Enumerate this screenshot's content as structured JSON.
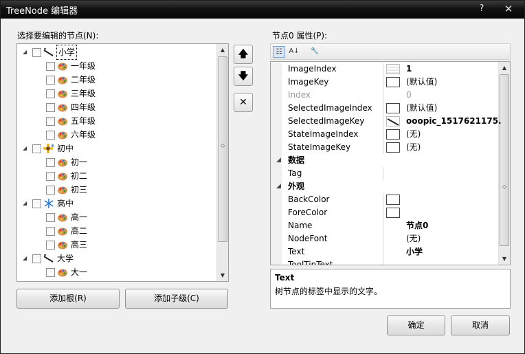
{
  "window": {
    "title": "TreeNode 编辑器",
    "help_glyph": "?",
    "close_glyph": "✕"
  },
  "tree_label": "选择要编辑的节点(N):",
  "tree": {
    "selected": "小学",
    "nodes": [
      {
        "label": "小学",
        "level": 0,
        "icon": "pen-icon",
        "expanded": true
      },
      {
        "label": "一年级",
        "level": 1,
        "icon": "palette-icon"
      },
      {
        "label": "二年级",
        "level": 1,
        "icon": "palette-icon"
      },
      {
        "label": "三年级",
        "level": 1,
        "icon": "palette-icon"
      },
      {
        "label": "四年级",
        "level": 1,
        "icon": "palette-icon"
      },
      {
        "label": "五年级",
        "level": 1,
        "icon": "palette-icon"
      },
      {
        "label": "六年级",
        "level": 1,
        "icon": "palette-icon"
      },
      {
        "label": "初中",
        "level": 0,
        "icon": "sunflower-icon",
        "expanded": true
      },
      {
        "label": "初一",
        "level": 1,
        "icon": "palette-icon"
      },
      {
        "label": "初二",
        "level": 1,
        "icon": "palette-icon"
      },
      {
        "label": "初三",
        "level": 1,
        "icon": "palette-icon"
      },
      {
        "label": "高中",
        "level": 0,
        "icon": "snowflake-icon",
        "expanded": true
      },
      {
        "label": "高一",
        "level": 1,
        "icon": "palette-icon"
      },
      {
        "label": "高二",
        "level": 1,
        "icon": "palette-icon"
      },
      {
        "label": "高三",
        "level": 1,
        "icon": "palette-icon"
      },
      {
        "label": "大学",
        "level": 0,
        "icon": "pen-icon",
        "expanded": true
      },
      {
        "label": "大一",
        "level": 1,
        "icon": "palette-icon"
      }
    ]
  },
  "side_buttons": {
    "up": "🡅",
    "down": "🡇",
    "delete": "✕"
  },
  "buttons": {
    "add_root": "添加根(R)",
    "add_child": "添加子级(C)",
    "ok": "确定",
    "cancel": "取消"
  },
  "properties_label": "节点0 属性(P):",
  "property_grid": {
    "rows": [
      {
        "kind": "prop",
        "name": "ImageIndex",
        "value": "1",
        "swatch": "image",
        "bold": true
      },
      {
        "kind": "prop",
        "name": "ImageKey",
        "value": "(默认值)",
        "swatch": "empty"
      },
      {
        "kind": "prop",
        "name": "Index",
        "value": "0",
        "dim": true
      },
      {
        "kind": "prop",
        "name": "SelectedImageIndex",
        "value": "(默认值)",
        "swatch": "empty"
      },
      {
        "kind": "prop",
        "name": "SelectedImageKey",
        "value": "ooopic_1517621175.",
        "swatch": "pen",
        "bold": true
      },
      {
        "kind": "prop",
        "name": "StateImageIndex",
        "value": "(无)",
        "swatch": "empty"
      },
      {
        "kind": "prop",
        "name": "StateImageKey",
        "value": "(无)",
        "swatch": "empty"
      },
      {
        "kind": "cat",
        "name": "数据"
      },
      {
        "kind": "prop",
        "name": "Tag",
        "value": ""
      },
      {
        "kind": "cat",
        "name": "外观"
      },
      {
        "kind": "prop",
        "name": "BackColor",
        "value": "",
        "swatch": "empty"
      },
      {
        "kind": "prop",
        "name": "ForeColor",
        "value": "",
        "swatch": "empty"
      },
      {
        "kind": "prop",
        "name": "Name",
        "value": "节点0",
        "bold": true
      },
      {
        "kind": "prop",
        "name": "NodeFont",
        "value": "(无)"
      },
      {
        "kind": "prop",
        "name": "Text",
        "value": "小学",
        "bold": true
      },
      {
        "kind": "prop",
        "name": "ToolTipText",
        "value": ""
      }
    ]
  },
  "description": {
    "title": "Text",
    "text": "树节点的标签中显示的文字。"
  }
}
